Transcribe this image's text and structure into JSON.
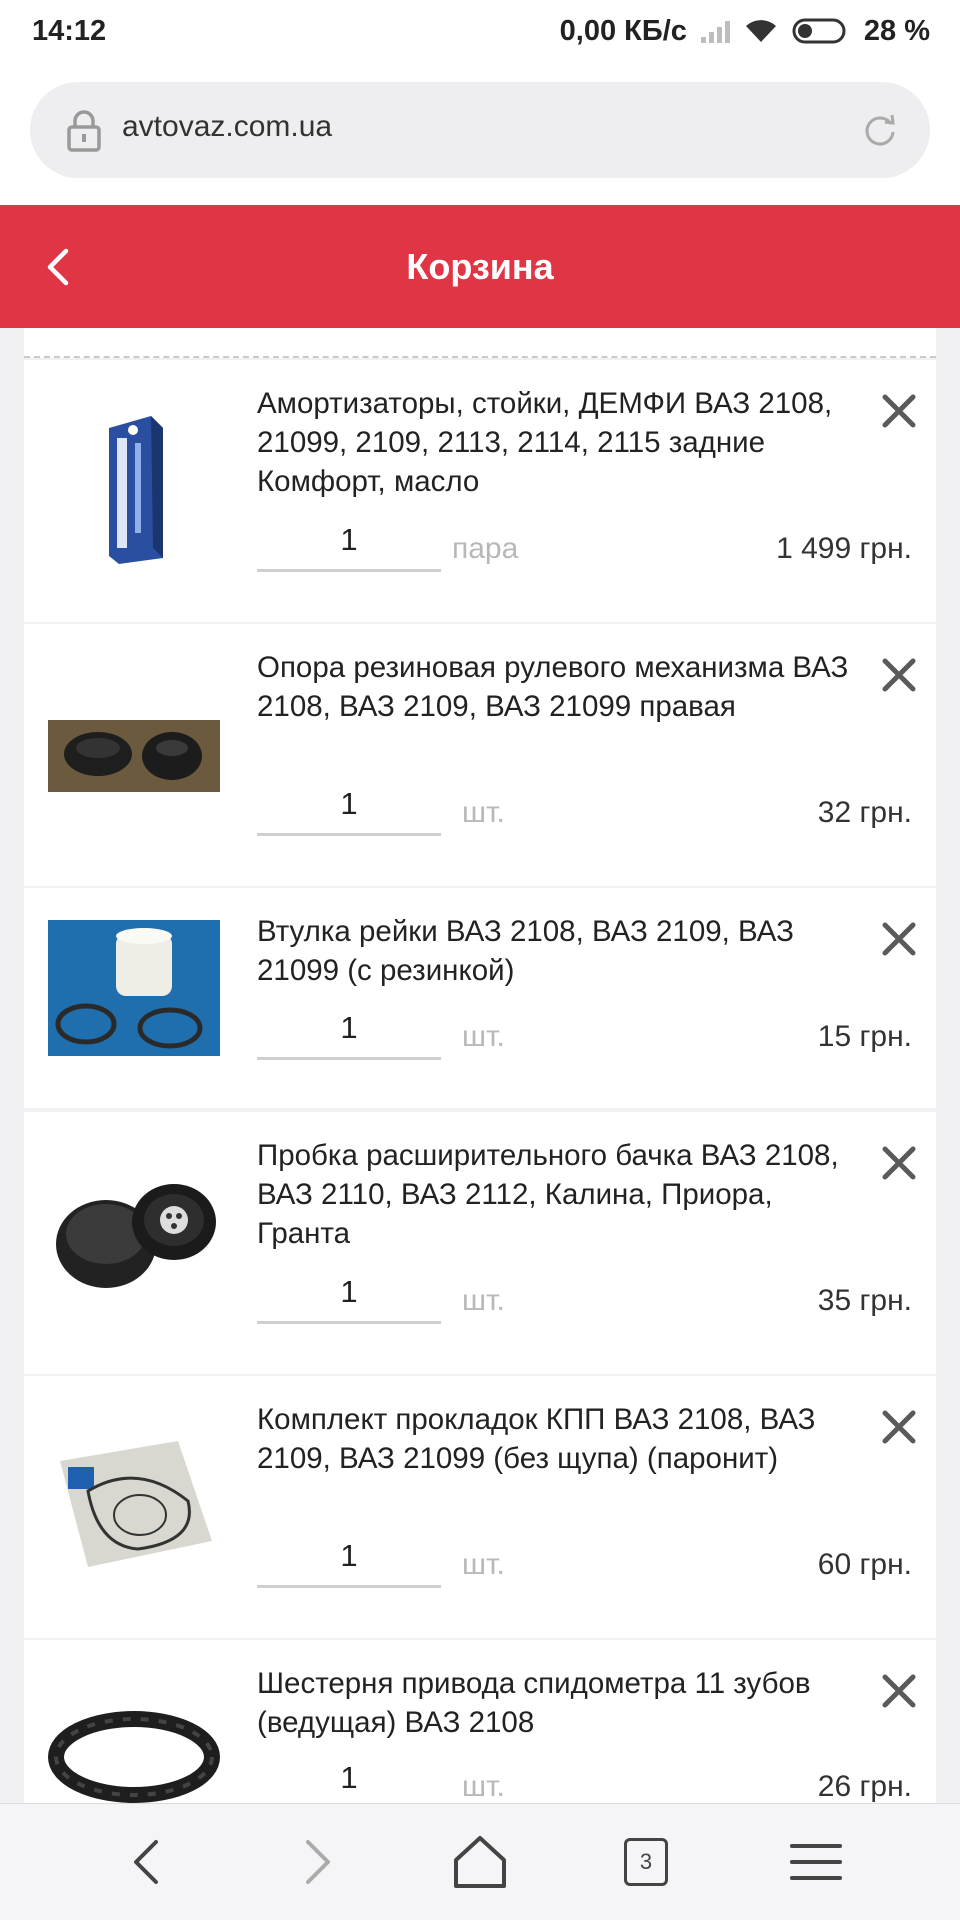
{
  "status_bar": {
    "time": "14:12",
    "network_speed": "0,00 КБ/с",
    "battery": "28 %"
  },
  "browser": {
    "url": "avtovaz.com.ua",
    "tabs_count": "3"
  },
  "header": {
    "title": "Корзина"
  },
  "cart": {
    "items": [
      {
        "title": "Амортизаторы, стойки, ДЕМФИ ВАЗ 2108, 21099, 2109, 2113, 2114, 2115 задние Комфорт, масло",
        "quantity": "1",
        "unit": "пара",
        "price": "1 499 грн."
      },
      {
        "title": "Опора резиновая рулевого механизма ВАЗ 2108, ВАЗ 2109, ВАЗ 21099 правая",
        "quantity": "1",
        "unit": "шт.",
        "price": "32 грн."
      },
      {
        "title": "Втулка рейки ВАЗ 2108, ВАЗ 2109, ВАЗ 21099 (с резинкой)",
        "quantity": "1",
        "unit": "шт.",
        "price": "15 грн."
      },
      {
        "title": "Пробка расширительного бачка ВАЗ 2108, ВАЗ 2110, ВАЗ 2112, Калина, Приора, Гранта",
        "quantity": "1",
        "unit": "шт.",
        "price": "35 грн."
      },
      {
        "title": "Комплект прокладок КПП ВАЗ 2108, ВАЗ 2109, ВАЗ 21099 (без щупа) (паронит)",
        "quantity": "1",
        "unit": "шт.",
        "price": "60 грн."
      },
      {
        "title": "Шестерня привода спидометра 11 зубов (ведущая) ВАЗ 2108",
        "quantity": "1",
        "unit": "шт.",
        "price": "26 грн."
      }
    ]
  },
  "colors": {
    "header_bg": "#e03545",
    "page_bg": "#f1f1f3",
    "card_bg": "#ffffff"
  },
  "icons": {
    "back": "chevron-left-icon",
    "remove": "close-icon",
    "lock": "lock-icon",
    "reload": "reload-icon"
  }
}
